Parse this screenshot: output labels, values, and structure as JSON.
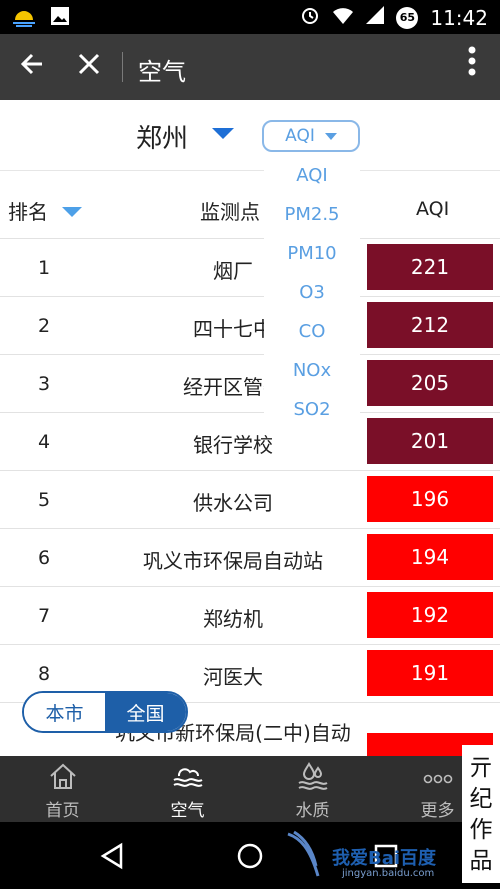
{
  "status_bar": {
    "time": "11:42",
    "notification_badge": "65"
  },
  "app_bar": {
    "title": "空气"
  },
  "city_selector": {
    "city": "郑州",
    "metric": "AQI"
  },
  "metric_options": [
    "AQI",
    "PM2.5",
    "PM10",
    "O3",
    "CO",
    "NOx",
    "SO2"
  ],
  "table": {
    "headers": {
      "rank": "排名",
      "station": "监测点",
      "aqi": "AQI"
    },
    "rows": [
      {
        "rank": "1",
        "station": "烟厂",
        "aqi": "221",
        "color": "#7a0f28"
      },
      {
        "rank": "2",
        "station": "四十七中",
        "aqi": "212",
        "color": "#7a0f28"
      },
      {
        "rank": "3",
        "station": "经开区管委",
        "aqi": "205",
        "color": "#7a0f28"
      },
      {
        "rank": "4",
        "station": "银行学校",
        "aqi": "201",
        "color": "#7a0f28"
      },
      {
        "rank": "5",
        "station": "供水公司",
        "aqi": "196",
        "color": "#ff0000"
      },
      {
        "rank": "6",
        "station": "巩义市环保局自动站",
        "aqi": "194",
        "color": "#ff0000"
      },
      {
        "rank": "7",
        "station": "郑纺机",
        "aqi": "192",
        "color": "#ff0000"
      },
      {
        "rank": "8",
        "station": "河医大",
        "aqi": "191",
        "color": "#ff0000"
      },
      {
        "rank": "",
        "station": "巩义市新环保局(二中)自动",
        "aqi": "",
        "color": "#ff0000"
      }
    ]
  },
  "scope_toggle": {
    "city": "本市",
    "nation": "全国"
  },
  "tabs": [
    {
      "label": "首页",
      "icon": "home-icon"
    },
    {
      "label": "空气",
      "icon": "air-icon"
    },
    {
      "label": "水质",
      "icon": "water-icon"
    },
    {
      "label": "更多",
      "icon": "more-icon"
    }
  ],
  "watermark": {
    "text": "我爱Bai百度",
    "sub": "jingyan.baidu.com",
    "stamp": [
      "亓",
      "纪",
      "作",
      "品"
    ]
  },
  "colors": {
    "appbar": "#3a3a3a",
    "accent_blue": "#5a9fe2",
    "level_severe": "#7a0f28",
    "level_heavy": "#ff0000"
  }
}
